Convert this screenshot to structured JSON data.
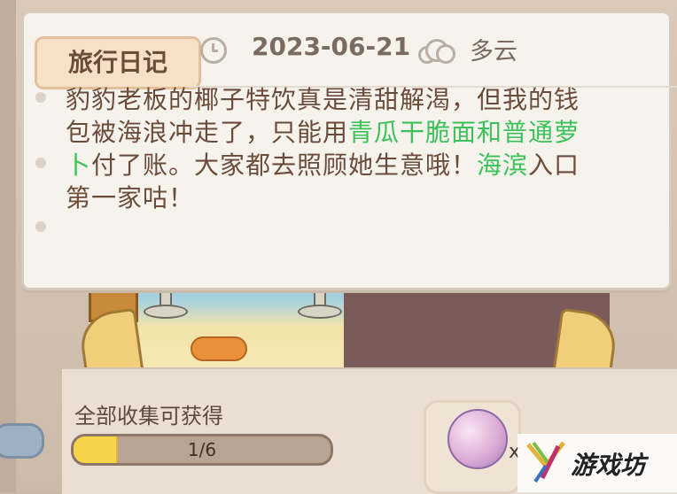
{
  "diary": {
    "tab_title": "旅行日记",
    "date": "2023-06-21",
    "weather": "多云",
    "icons": {
      "date": "clock-icon",
      "weather": "cloud-icon"
    },
    "text": {
      "part1": "豹豹老板的椰子特饮真是清甜解渴，但我的钱包被海浪冲走了，只能用",
      "highlight1": "青瓜干脆面和普通萝卜",
      "part2": "付了账。大家都去照顾她生意哦！",
      "highlight2": "海滨",
      "part3": "入口第一家咕！"
    },
    "highlight_color": "#3cc25a"
  },
  "collection": {
    "label": "全部收集可获得",
    "progress_text": "1/6",
    "progress_current": 1,
    "progress_total": 6,
    "reward_icon": "candy-icon",
    "reward_count": "x"
  },
  "watermark": {
    "text": "游戏坊"
  }
}
